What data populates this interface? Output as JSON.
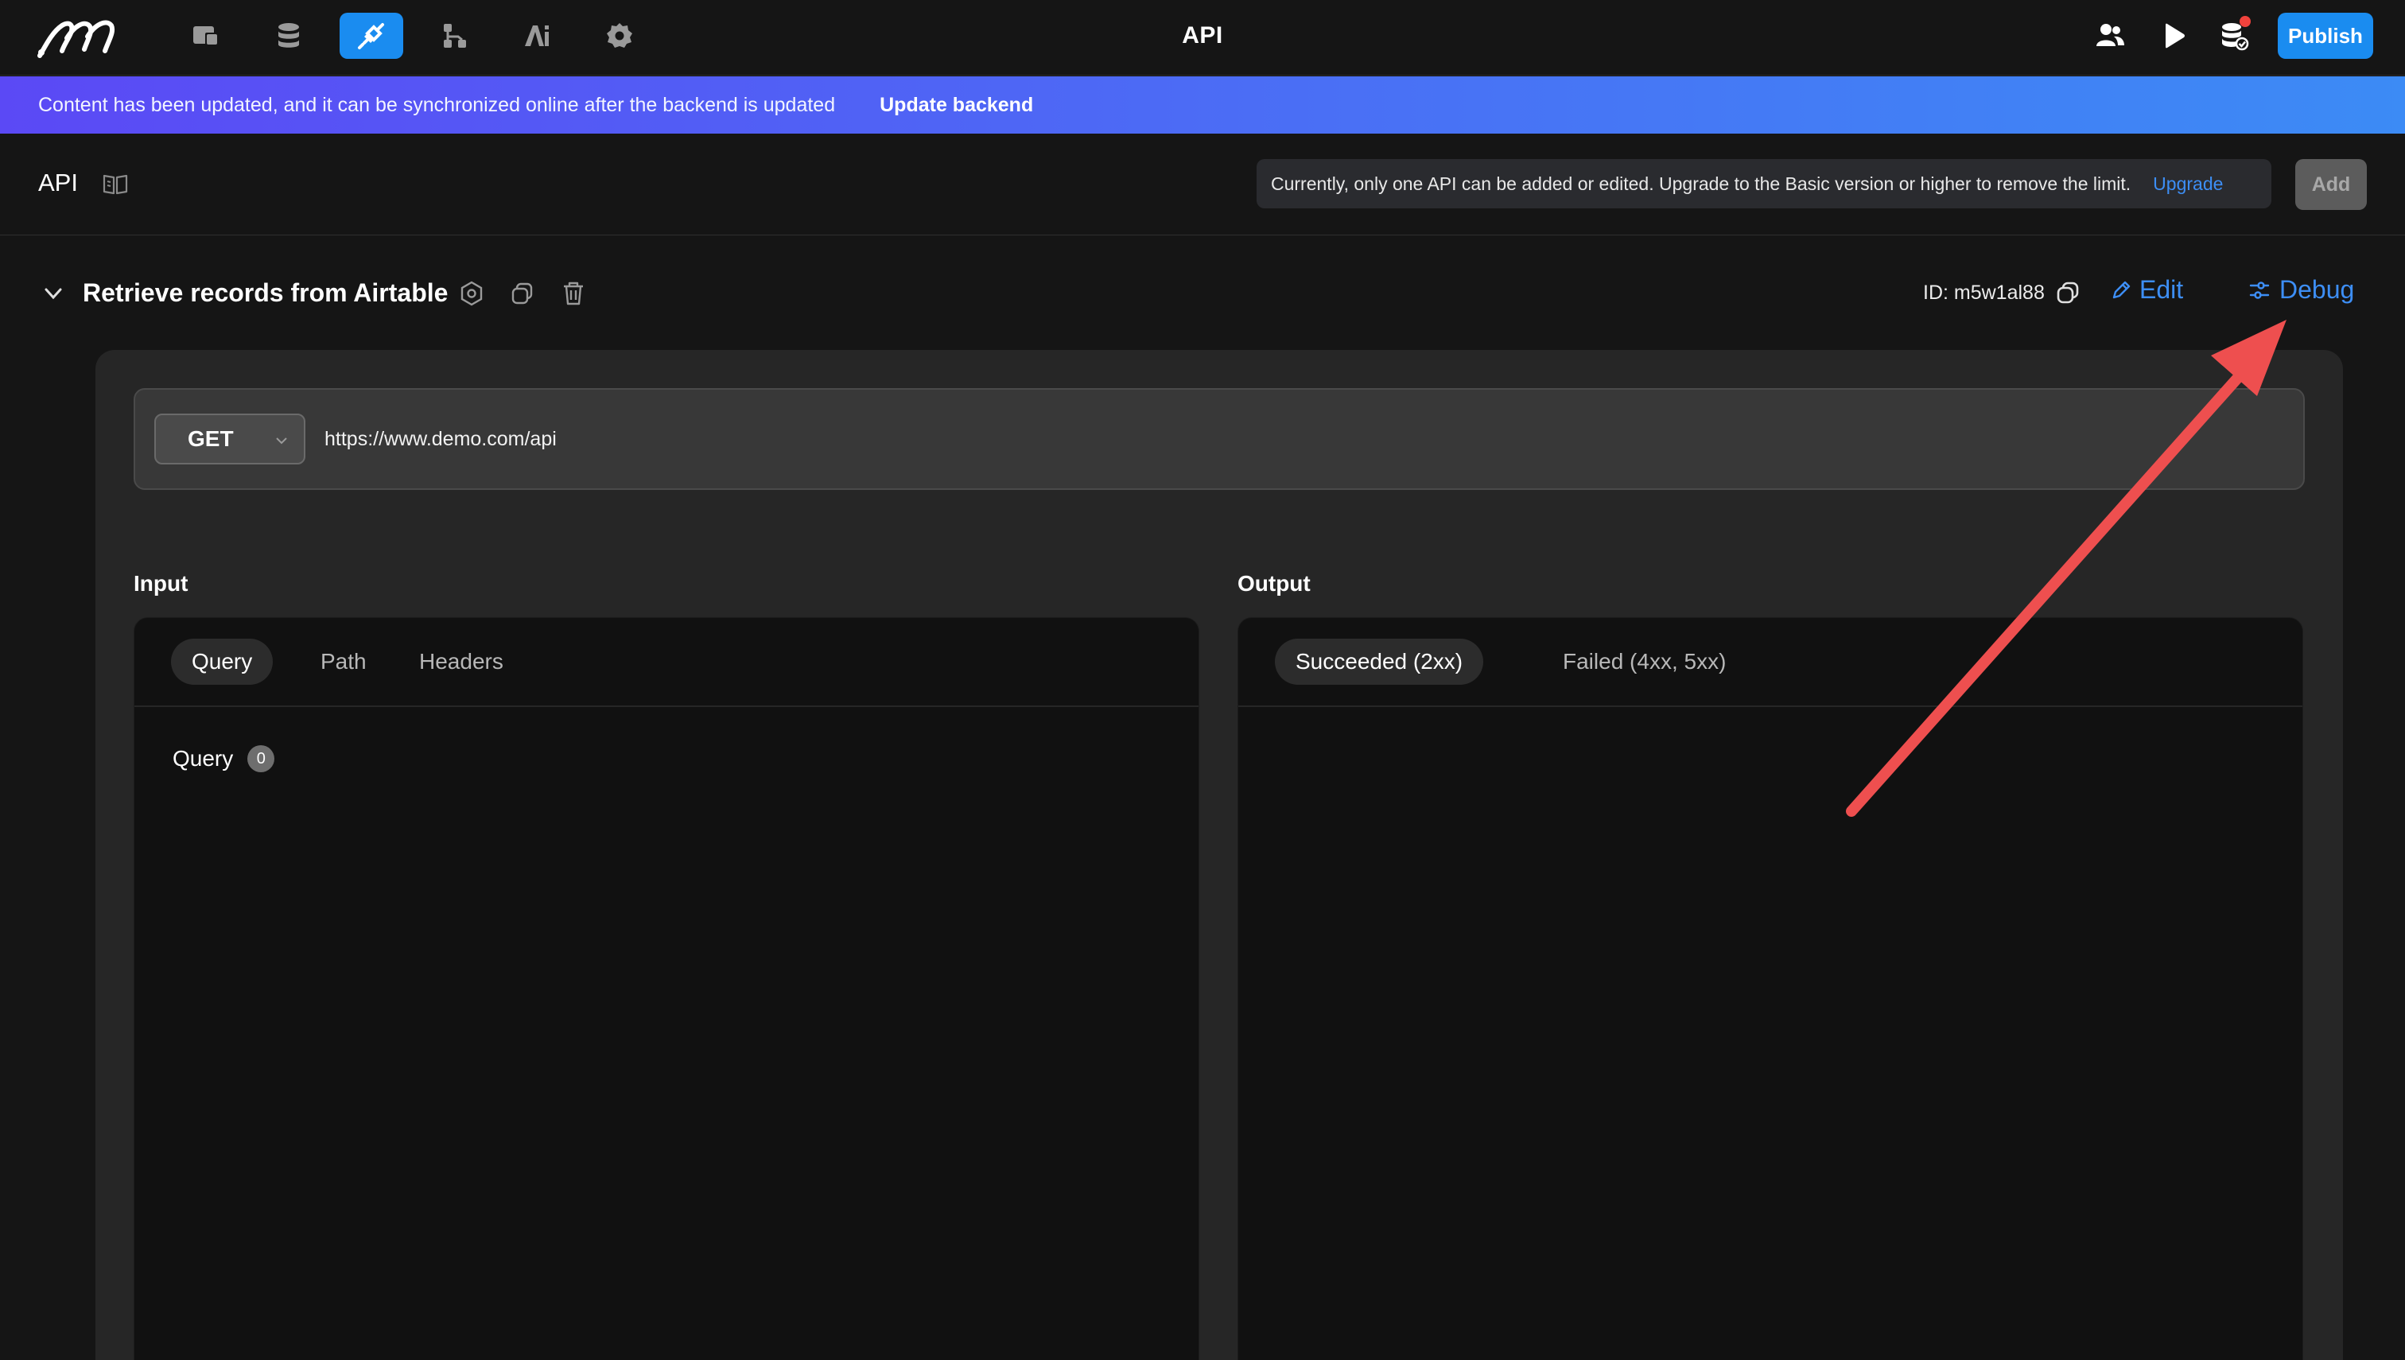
{
  "topbar": {
    "title": "API",
    "publish_label": "Publish",
    "nav_icons": [
      "pages-icon",
      "database-icon",
      "api-plug-icon",
      "workflow-icon",
      "ai-icon",
      "settings-gear-icon"
    ],
    "active_nav": "api-plug-icon",
    "right_icons": [
      "users-icon",
      "play-icon",
      "database-check-icon"
    ]
  },
  "banner": {
    "message": "Content has been updated, and it can be synchronized online after the backend is updated",
    "action": "Update backend"
  },
  "subheader": {
    "title": "API",
    "limit_message": "Currently, only one API can be added or edited. Upgrade to the Basic version or higher to remove the limit.",
    "upgrade_label": "Upgrade",
    "add_label": "Add"
  },
  "api": {
    "name": "Retrieve records from Airtable",
    "id_text": "ID: m5w1al88",
    "edit_label": "Edit",
    "debug_label": "Debug",
    "method": "GET",
    "url": "https://www.demo.com/api"
  },
  "input": {
    "label": "Input",
    "tabs": [
      "Query",
      "Path",
      "Headers"
    ],
    "active_tab": "Query",
    "query_label": "Query",
    "query_count": "0"
  },
  "output": {
    "label": "Output",
    "tabs": [
      "Succeeded (2xx)",
      "Failed (4xx, 5xx)"
    ],
    "active_tab": "Succeeded (2xx)"
  },
  "colors": {
    "accent": "#1a8cf0",
    "link": "#3d8ef5",
    "banner_start": "#5b49f5",
    "banner_end": "#3c8bf5",
    "annotation_arrow": "#ee4f4f"
  }
}
